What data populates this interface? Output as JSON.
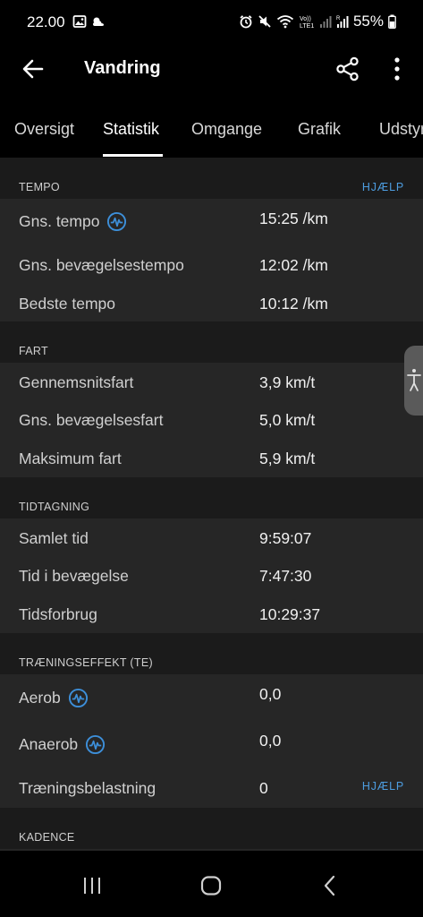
{
  "status_bar": {
    "time": "22.00",
    "battery": "55%",
    "network_label": "VoLTE1"
  },
  "app_bar": {
    "title": "Vandring"
  },
  "tabs": [
    {
      "label": "Oversigt",
      "active": false
    },
    {
      "label": "Statistik",
      "active": true
    },
    {
      "label": "Omgange",
      "active": false
    },
    {
      "label": "Grafik",
      "active": false
    },
    {
      "label": "Udstyr",
      "active": false
    }
  ],
  "sections": {
    "tempo": {
      "title": "TEMPO",
      "help": "HJÆLP",
      "rows": [
        {
          "label": "Gns. tempo",
          "value": "15:25 /km"
        },
        {
          "label": "Gns. bevægelsestempo",
          "value": "12:02 /km"
        },
        {
          "label": "Bedste tempo",
          "value": "10:12 /km"
        }
      ]
    },
    "fart": {
      "title": "FART",
      "rows": [
        {
          "label": "Gennemsnitsfart",
          "value": "3,9 km/t"
        },
        {
          "label": "Gns. bevægelsesfart",
          "value": "5,0 km/t"
        },
        {
          "label": "Maksimum fart",
          "value": "5,9 km/t"
        }
      ]
    },
    "tidtagning": {
      "title": "TIDTAGNING",
      "rows": [
        {
          "label": "Samlet tid",
          "value": "9:59:07"
        },
        {
          "label": "Tid i bevægelse",
          "value": "7:47:30"
        },
        {
          "label": "Tidsforbrug",
          "value": "10:29:37"
        }
      ]
    },
    "traeningseffekt": {
      "title": "TRÆNINGSEFFEKT (TE)",
      "help": "HJÆLP",
      "rows": [
        {
          "label": "Aerob",
          "value": "0,0"
        },
        {
          "label": "Anaerob",
          "value": "0,0"
        },
        {
          "label": "Træningsbelastning",
          "value": "0"
        }
      ]
    },
    "kadence": {
      "title": "KADENCE"
    }
  },
  "colors": {
    "background": "#000000",
    "panel": "#262626",
    "header_bg": "#1b1b1b",
    "accent_link": "#4d9de0",
    "info_icon": "#3d8fd9"
  },
  "icons": {
    "back": "arrow-left-icon",
    "share": "share-icon",
    "more": "more-vertical-icon",
    "info": "heartbeat-info-icon",
    "accessibility": "accessibility-icon",
    "nav_recents": "recents-icon",
    "nav_home": "home-icon",
    "nav_back": "nav-back-icon"
  }
}
